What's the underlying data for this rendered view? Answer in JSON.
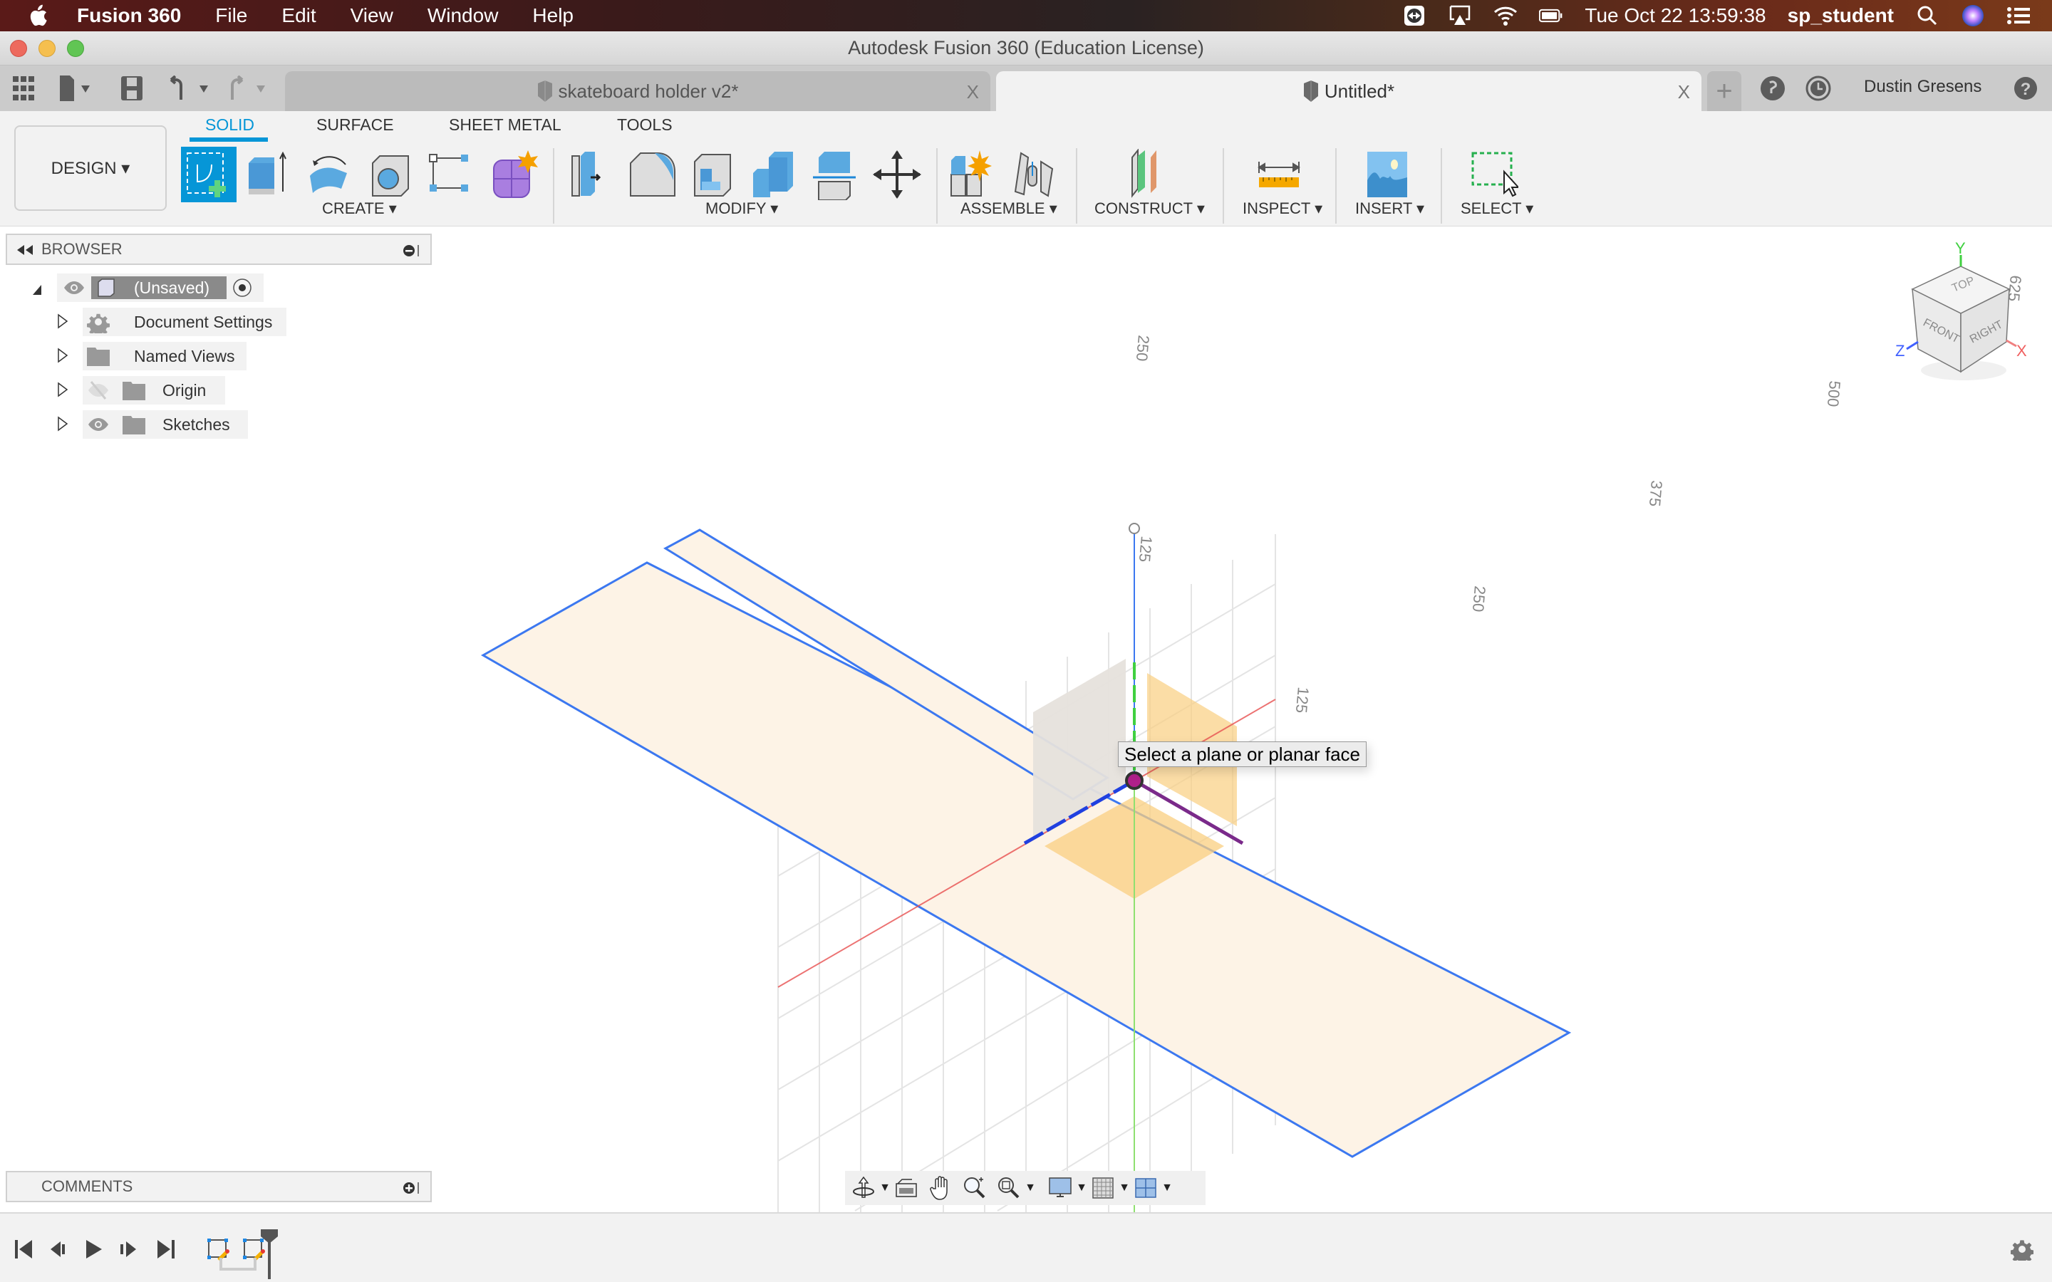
{
  "menubar": {
    "app_name": "Fusion 360",
    "items": [
      "File",
      "Edit",
      "View",
      "Window",
      "Help"
    ],
    "datetime": "Tue Oct 22  13:59:38",
    "username": "sp_student",
    "status_icons": [
      "teamviewer-icon",
      "airplay-icon",
      "wifi-icon",
      "battery-icon",
      "spotlight-icon",
      "siri-icon",
      "notification-center-icon"
    ]
  },
  "window": {
    "title": "Autodesk Fusion 360 (Education License)"
  },
  "tabs": [
    {
      "label": "skateboard holder v2*",
      "active": false
    },
    {
      "label": "Untitled*",
      "active": true
    }
  ],
  "tabbar": {
    "user_name": "Dustin Gresens",
    "close_glyph": "X",
    "new_tab_glyph": "+"
  },
  "ribbon": {
    "workspace": "DESIGN ▾",
    "tabs": [
      "SOLID",
      "SURFACE",
      "SHEET METAL",
      "TOOLS"
    ],
    "active_tab": "SOLID",
    "groups": {
      "create": "CREATE ▾",
      "modify": "MODIFY ▾",
      "assemble": "ASSEMBLE ▾",
      "construct": "CONSTRUCT ▾",
      "inspect": "INSPECT ▾",
      "insert": "INSERT ▾",
      "select": "SELECT ▾"
    }
  },
  "browser": {
    "title": "BROWSER",
    "root": "(Unsaved)",
    "items": [
      {
        "label": "Document Settings",
        "icon": "gear-icon"
      },
      {
        "label": "Named Views",
        "icon": "folder-icon"
      },
      {
        "label": "Origin",
        "icon": "folder-icon",
        "visibility": "hidden"
      },
      {
        "label": "Sketches",
        "icon": "folder-icon",
        "visibility": "visible"
      }
    ]
  },
  "comments": {
    "title": "COMMENTS"
  },
  "viewport": {
    "tooltip": "Select a plane or planar face",
    "dimension_labels": [
      "250",
      "500",
      "375",
      "125",
      "250",
      "125",
      "625"
    ],
    "viewcube": {
      "top": "TOP",
      "front": "FRONT",
      "right": "RIGHT",
      "axes": [
        "X",
        "Y",
        "Z"
      ]
    },
    "colors": {
      "x_axis": "#e85050",
      "y_axis": "#40d040",
      "z_axis": "#4060ff",
      "sketch_line": "#3c78f0",
      "plane_fill": "#fdf1e2",
      "origin_plane": "#f9cf80"
    }
  }
}
